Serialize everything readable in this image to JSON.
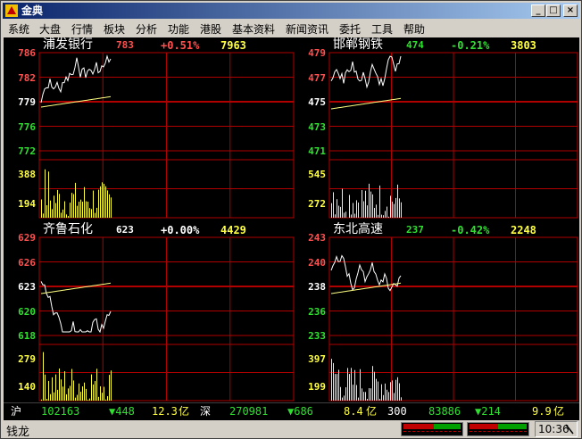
{
  "window": {
    "title": "金典",
    "controls": [
      "_",
      "□",
      "×"
    ]
  },
  "menu": [
    "系统",
    "大盘",
    "行情",
    "板块",
    "分析",
    "功能",
    "港股",
    "基本资料",
    "新闻资讯",
    "委托",
    "工具",
    "帮助"
  ],
  "colors": {
    "up": "#ff5050",
    "down": "#30e030",
    "flat": "#ffffff",
    "volume": "#ffff40",
    "grid": "#b00000",
    "avg": "#ffff80"
  },
  "quotes": [
    {
      "name": "浦发银行",
      "price": "783",
      "change": "+0.51%",
      "volume": "7963",
      "trend": "up",
      "y_labels": [
        {
          "text": "786",
          "c": "up"
        },
        {
          "text": "782",
          "c": "up"
        },
        {
          "text": "779",
          "c": "flat"
        },
        {
          "text": "776",
          "c": "down"
        },
        {
          "text": "772",
          "c": "down"
        }
      ],
      "vol_labels": [
        "388",
        "194"
      ]
    },
    {
      "name": "邯郸钢铁",
      "price": "474",
      "change": "-0.21%",
      "volume": "3803",
      "trend": "down",
      "y_labels": [
        {
          "text": "479",
          "c": "up"
        },
        {
          "text": "477",
          "c": "up"
        },
        {
          "text": "475",
          "c": "flat"
        },
        {
          "text": "473",
          "c": "down"
        },
        {
          "text": "471",
          "c": "down"
        }
      ],
      "vol_labels": [
        "545",
        "272"
      ]
    },
    {
      "name": "齐鲁石化",
      "price": "623",
      "change": "+0.00%",
      "volume": "4429",
      "trend": "flat",
      "y_labels": [
        {
          "text": "629",
          "c": "up"
        },
        {
          "text": "626",
          "c": "up"
        },
        {
          "text": "623",
          "c": "flat"
        },
        {
          "text": "620",
          "c": "down"
        },
        {
          "text": "618",
          "c": "down"
        }
      ],
      "vol_labels": [
        "279",
        "140"
      ]
    },
    {
      "name": "东北高速",
      "price": "237",
      "change": "-0.42%",
      "volume": "2248",
      "trend": "down",
      "y_labels": [
        {
          "text": "243",
          "c": "up"
        },
        {
          "text": "240",
          "c": "up"
        },
        {
          "text": "238",
          "c": "flat"
        },
        {
          "text": "236",
          "c": "down"
        },
        {
          "text": "233",
          "c": "down"
        }
      ],
      "vol_labels": [
        "397",
        "199"
      ]
    }
  ],
  "status": {
    "sh_label": "沪",
    "sh_index": "102163",
    "sh_change": "▼448",
    "sh_amount": "12.3",
    "sh_unit": "亿",
    "sz_label": "深",
    "sz_index": "270981",
    "sz_change": "▼686",
    "sz_amount": "8.4",
    "sz_unit": "亿",
    "idx_300_label": "300",
    "idx_300": "83886",
    "idx_300_change": "▼214",
    "idx_300_amount": "9.9",
    "idx_300_unit": "亿"
  },
  "bottom": {
    "brand": "钱龙",
    "clock": "10:36"
  }
}
